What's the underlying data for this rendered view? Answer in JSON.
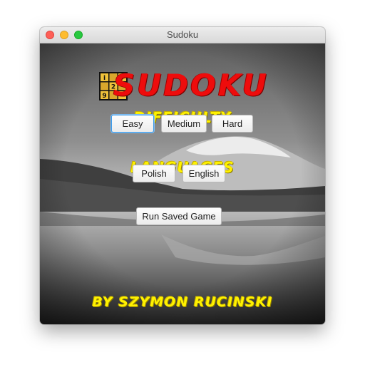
{
  "window": {
    "title": "Sudoku"
  },
  "app": {
    "title": "SUDOKU",
    "difficulty_heading": "DIFFICULTY",
    "difficulty_buttons": [
      "Easy",
      "Medium",
      "Hard"
    ],
    "languages_heading": "LANGUAGES",
    "language_buttons": [
      "Polish",
      "English"
    ],
    "run_saved_label": "Run Saved Game",
    "author": "BY SZYMON RUCINSKI"
  },
  "logo": {
    "cells": [
      "i",
      "",
      "",
      "2",
      "",
      "9",
      "",
      ""
    ]
  },
  "colors": {
    "title_red": "#ee0c0c",
    "heading_yellow": "#fff200",
    "focus_blue": "#3d9be9"
  }
}
